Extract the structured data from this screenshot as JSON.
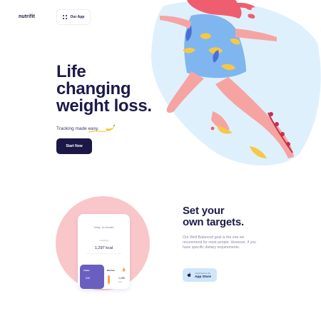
{
  "header": {
    "brand": "nutrifit",
    "our_app_label": "Our App"
  },
  "hero": {
    "headline_lines": [
      "Life",
      "changing",
      "weight loss."
    ],
    "tagline": "Tracking made easy.",
    "cta_label": "Start Now"
  },
  "phone": {
    "date": "Today, 14 minutes",
    "remaining_label": "remaining",
    "kcal": "1,297 kcal",
    "card_a": {
      "title": "Intake",
      "value": "626"
    },
    "card_b": {
      "title": "Burned",
      "value": "1,298",
      "sub": "kcal"
    }
  },
  "targets": {
    "title_lines": [
      "Set your",
      "own targets."
    ],
    "description": "Our Well Balanced goal is the one we recommend for most people. However, if you have specific dietary requirements.",
    "appstore_small": "Download on the",
    "appstore_label": "App Store"
  },
  "colors": {
    "navy": "#1c1a4a",
    "button": "#1b1746",
    "blob_blue": "#dff0fd",
    "pink_circle": "#f9c7c9",
    "appstore_bg": "#cfe6fb",
    "card_purple": "#6a5fc1"
  }
}
